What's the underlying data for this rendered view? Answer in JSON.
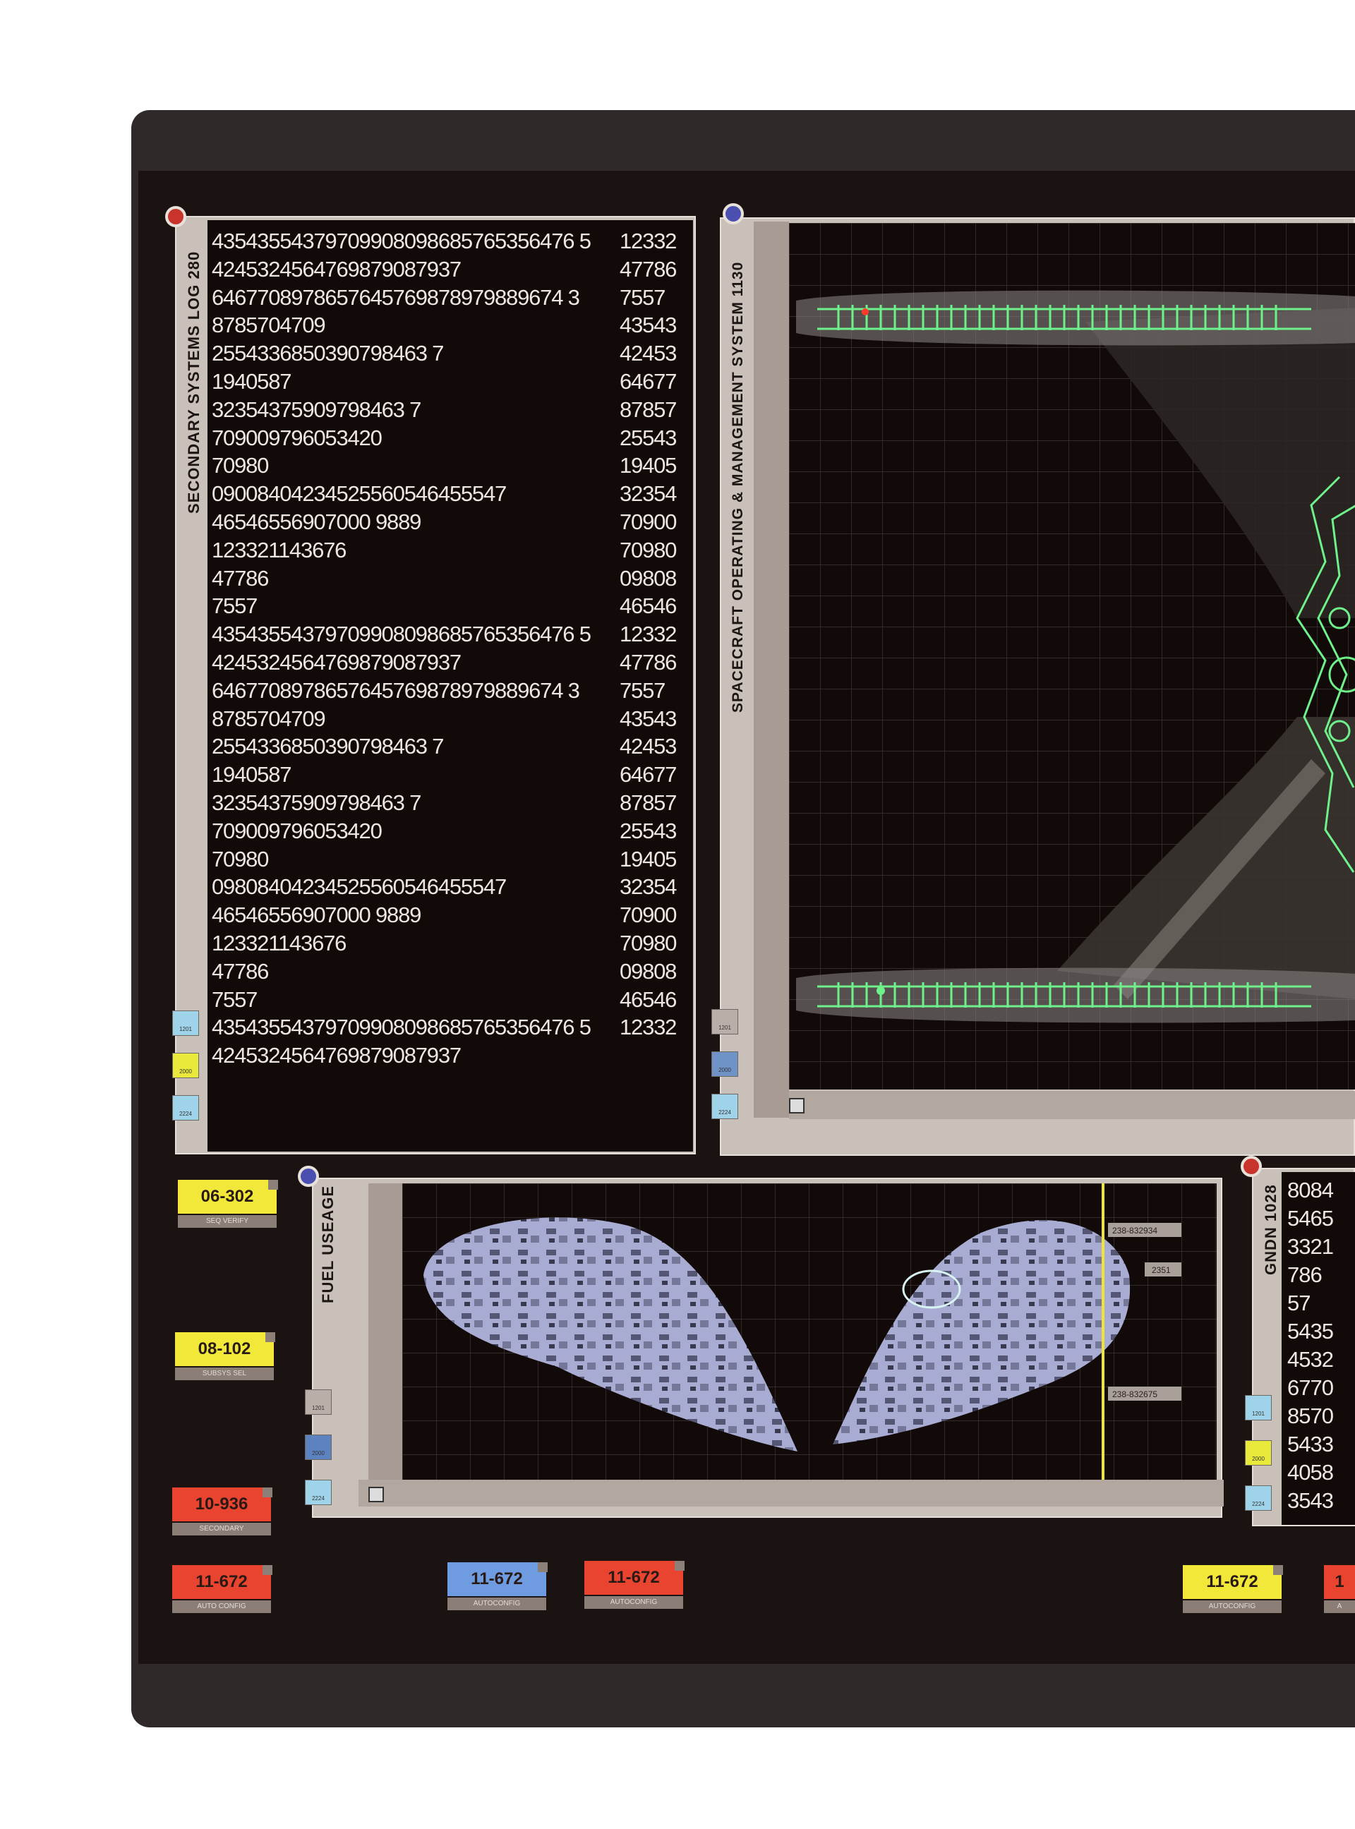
{
  "log_panel": {
    "title": "SECONDARY SYSTEMS LOG 280",
    "rows": [
      {
        "a": "43543554379709908098685765356476 5",
        "b": "12332"
      },
      {
        "a": "4245324564769879087937",
        "b": "47786"
      },
      {
        "a": "6467708978657645769878979889674 3",
        "b": "7557"
      },
      {
        "a": "8785704709",
        "b": "43543"
      },
      {
        "a": "2554336850390798463 7",
        "b": "42453"
      },
      {
        "a": "1940587",
        "b": "64677"
      },
      {
        "a": "32354375909798463 7",
        "b": "87857"
      },
      {
        "a": "709009796053420",
        "b": "25543"
      },
      {
        "a": "70980",
        "b": "19405"
      },
      {
        "a": "09008404234525560546455547",
        "b": "32354"
      },
      {
        "a": "46546556907000 9889",
        "b": "70900"
      },
      {
        "a": "123321143676",
        "b": "70980"
      },
      {
        "a": "47786",
        "b": "09808"
      },
      {
        "a": "7557",
        "b": "46546"
      },
      {
        "a": "43543554379709908098685765356476 5",
        "b": "12332"
      },
      {
        "a": "4245324564769879087937",
        "b": "47786"
      },
      {
        "a": "6467708978657645769878979889674 3",
        "b": "7557"
      },
      {
        "a": "8785704709",
        "b": "43543"
      },
      {
        "a": "2554336850390798463 7",
        "b": "42453"
      },
      {
        "a": "1940587",
        "b": "64677"
      },
      {
        "a": "32354375909798463 7",
        "b": "87857"
      },
      {
        "a": "709009796053420",
        "b": "25543"
      },
      {
        "a": "70980",
        "b": "19405"
      },
      {
        "a": "09808404234525560546455547",
        "b": "32354"
      },
      {
        "a": "46546556907000 9889",
        "b": "70900"
      },
      {
        "a": "123321143676",
        "b": "70980"
      },
      {
        "a": "47786",
        "b": "09808"
      },
      {
        "a": "7557",
        "b": "46546"
      },
      {
        "a": "43543554379709908098685765356476 5",
        "b": "12332"
      },
      {
        "a": "4245324564769879087937",
        "b": ""
      }
    ],
    "tabs": [
      "1201",
      "2000",
      "2224"
    ]
  },
  "ops_panel": {
    "title": "SPACECRAFT OPERATING & MANAGEMENT SYSTEM 1130",
    "tabs": [
      "1201",
      "2000",
      "2224"
    ]
  },
  "fuel_panel": {
    "title": "FUEL USEAGE",
    "marker_labels": [
      "238-832934",
      "2351",
      "238-832675"
    ],
    "tabs": [
      "1201",
      "2000",
      "2224"
    ]
  },
  "gndn_panel": {
    "title": "GNDN 1028",
    "rows": [
      "8084",
      "5465",
      "3321",
      "786",
      "57",
      "5435",
      "4532",
      "6770",
      "8570",
      "5433",
      "4058",
      "3543"
    ],
    "tabs": [
      "1201",
      "2000",
      "2224"
    ]
  },
  "chips": [
    {
      "code": "06-302",
      "label": "SEQ VERIFY",
      "color": "#f1e83a"
    },
    {
      "code": "08-102",
      "label": "SUBSYS SEL",
      "color": "#f1e83a"
    },
    {
      "code": "10-936",
      "label": "SECONDARY",
      "color": "#e8442f"
    },
    {
      "code": "11-672",
      "label": "AUTO CONFIG",
      "color": "#e8442f"
    },
    {
      "code": "11-672",
      "label": "AUTOCONFIG",
      "color": "#6f9be0"
    },
    {
      "code": "11-672",
      "label": "AUTOCONFIG",
      "color": "#e8442f"
    },
    {
      "code": "11-672",
      "label": "AUTOCONFIG",
      "color": "#f1e83a"
    },
    {
      "code": "1",
      "label": "A",
      "color": "#e8442f"
    }
  ],
  "colors": {
    "red_knob": "#c8332b",
    "blue_knob": "#4b4fb0",
    "wireframe": "#6ef08a"
  }
}
